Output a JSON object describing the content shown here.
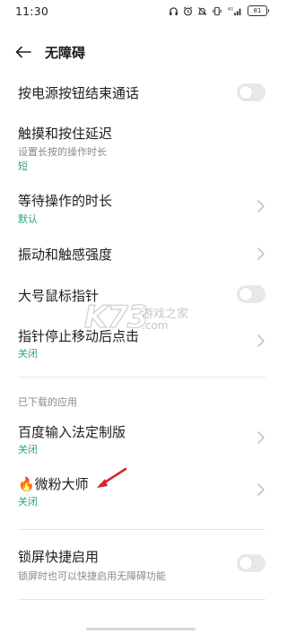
{
  "status_bar": {
    "time": "11:30",
    "battery": "81",
    "signal_label": "4G",
    "icons": [
      "headphones-icon",
      "alarm-icon",
      "mute-icon",
      "vibrate-icon",
      "signal-icon",
      "battery-icon"
    ]
  },
  "header": {
    "title": "无障碍",
    "back_icon": "back-arrow-icon"
  },
  "settings": [
    {
      "title": "按电源按钮结束通话",
      "control": "toggle",
      "on": false
    },
    {
      "title": "触摸和按住延迟",
      "subtitle": "设置长按的操作时长",
      "value": "短",
      "control": "none"
    },
    {
      "title": "等待操作的时长",
      "value": "默认",
      "control": "chevron"
    },
    {
      "title": "振动和触感强度",
      "control": "chevron"
    },
    {
      "title": "大号鼠标指针",
      "control": "toggle",
      "on": false
    },
    {
      "title": "指针停止移动后点击",
      "value": "关闭",
      "control": "chevron"
    }
  ],
  "downloaded_section": {
    "label": "已下载的应用",
    "items": [
      {
        "title": "百度输入法定制版",
        "value": "关闭",
        "control": "chevron"
      },
      {
        "title": "🔥微粉大师",
        "value": "关闭",
        "control": "chevron"
      }
    ]
  },
  "lock_screen": {
    "title": "锁屏快捷启用",
    "subtitle": "锁屏时也可以快捷启用无障碍功能",
    "control": "toggle",
    "on": false
  },
  "watermark": {
    "logo": "K73",
    "text": "游戏之家",
    "domain": ".com"
  },
  "colors": {
    "accent_green": "#2aa876",
    "toggle_off": "#e8e8e8",
    "annotation_arrow": "#d9232d"
  }
}
